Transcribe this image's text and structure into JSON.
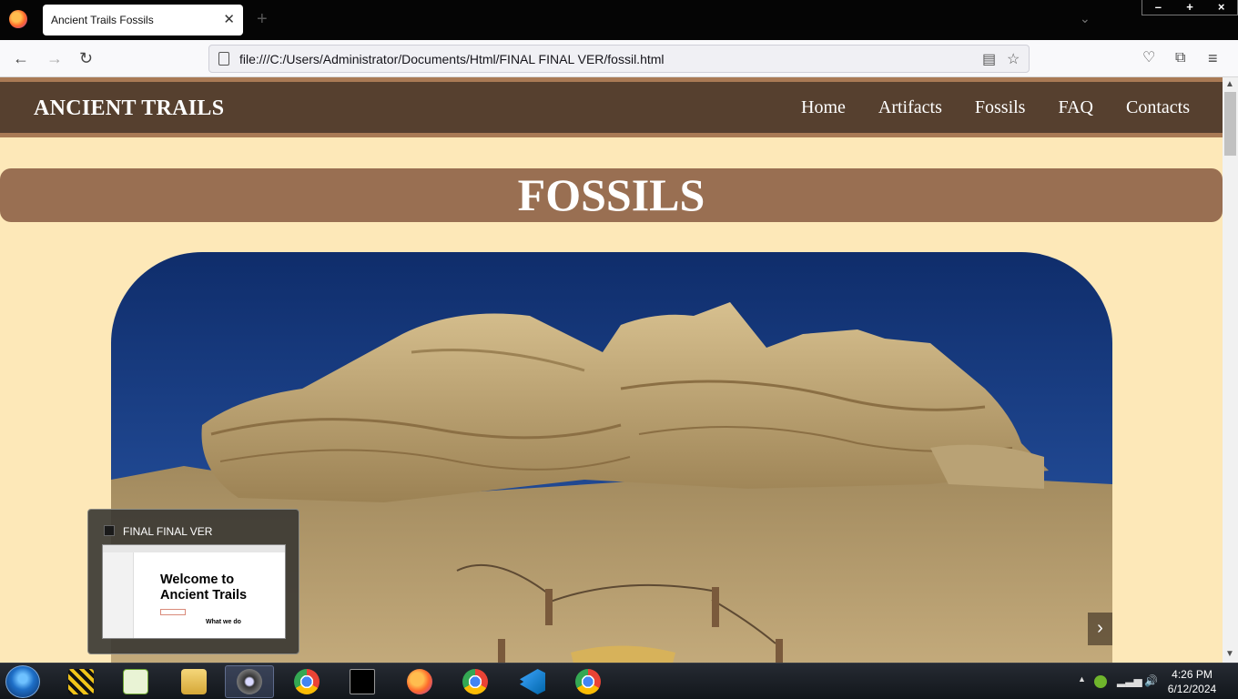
{
  "browser": {
    "tab_title": "Ancient Trails Fossils",
    "tab_close": "✕",
    "new_tab": "+",
    "url": "file:///C:/Users/Administrator/Documents/Html/FINAL FINAL VER/fossil.html"
  },
  "site": {
    "brand": "ANCIENT TRAILS",
    "menu": [
      "Home",
      "Artifacts",
      "Fossils",
      "FAQ",
      "Contacts"
    ],
    "page_title": "FOSSILS",
    "slider_next": "›"
  },
  "preview": {
    "title": "FINAL FINAL VER",
    "heading_line1": "Welcome to",
    "heading_line2": "Ancient Trails",
    "subheading": "What we do"
  },
  "taskbar": {
    "time": "4:26 PM",
    "date": "6/12/2024",
    "apps": [
      "ccleaner-icon",
      "notepad-plus-plus-icon",
      "file-explorer-icon",
      "camera-icon",
      "chrome-icon",
      "command-prompt-icon",
      "firefox-icon",
      "chrome-profile-icon",
      "vscode-icon",
      "chrome-icon"
    ]
  }
}
